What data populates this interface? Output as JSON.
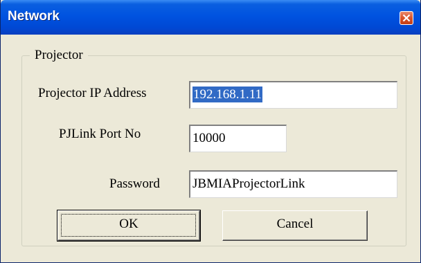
{
  "window": {
    "title": "Network",
    "close_icon": "close-icon"
  },
  "group": {
    "label": "Projector"
  },
  "fields": {
    "ip": {
      "label": "Projector IP Address",
      "value": "192.168.1.11",
      "selected": true
    },
    "port": {
      "label": "PJLink Port No",
      "value": "10000"
    },
    "password": {
      "label": "Password",
      "value": "JBMIAProjectorLink"
    }
  },
  "buttons": {
    "ok": "OK",
    "cancel": "Cancel"
  },
  "colors": {
    "titlebar": "#0053e0",
    "face": "#ece9d8",
    "selection": "#316ac5",
    "close": "#d9542c"
  }
}
